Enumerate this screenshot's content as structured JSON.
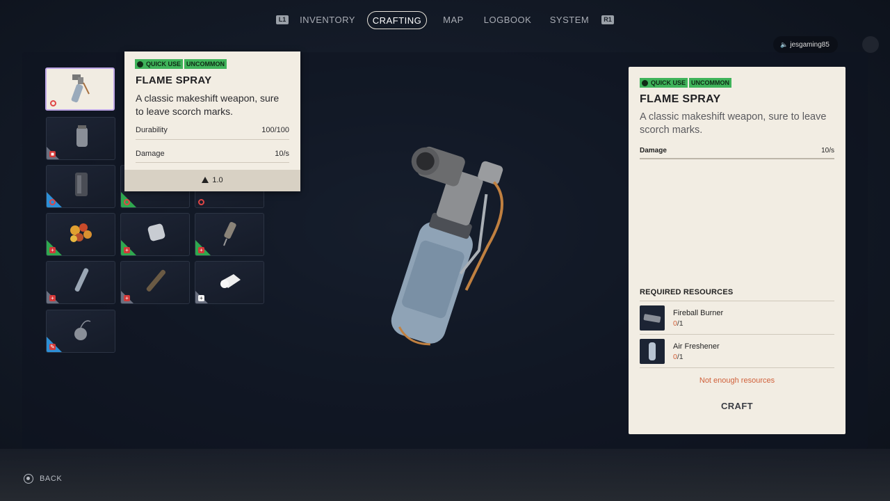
{
  "nav": {
    "left_shoulder": "L1",
    "right_shoulder": "R1",
    "tabs": [
      {
        "label": "INVENTORY"
      },
      {
        "label": "CRAFTING"
      },
      {
        "label": "MAP"
      },
      {
        "label": "LOGBOOK"
      },
      {
        "label": "SYSTEM"
      }
    ],
    "active_tab": "CRAFTING"
  },
  "user": {
    "username": "jesgaming85",
    "icon": "speaker-icon"
  },
  "grid": {
    "slots": [
      {
        "item": "flame-spray",
        "rarity": "uncommon",
        "badge": "ring",
        "selected": true
      },
      {
        "item": "canister",
        "rarity": "common",
        "badge": "red"
      },
      {
        "item": "backpack-weapon",
        "rarity": "rare",
        "badge": "ring"
      },
      {
        "item": "hidden-under-tooltip",
        "rarity": "uncommon",
        "badge": "ring"
      },
      {
        "item": "hidden-under-tooltip",
        "rarity": "common",
        "badge": "ring"
      },
      {
        "item": "fruit-pile",
        "rarity": "uncommon",
        "badge": "red"
      },
      {
        "item": "bandage-roll",
        "rarity": "uncommon",
        "badge": "red"
      },
      {
        "item": "syringe-injector",
        "rarity": "uncommon",
        "badge": "red"
      },
      {
        "item": "pipe-tube",
        "rarity": "common",
        "badge": "red"
      },
      {
        "item": "wrench-tool",
        "rarity": "common",
        "badge": "red"
      },
      {
        "item": "gauze-bandage",
        "rarity": "common",
        "badge": "white"
      },
      {
        "item": "pocket-watch",
        "rarity": "rare",
        "badge": "red"
      }
    ]
  },
  "tooltip": {
    "tags": [
      "QUICK USE",
      "UNCOMMON"
    ],
    "title": "FLAME SPRAY",
    "description": "A classic makeshift weapon, sure to leave scorch marks.",
    "stats": [
      {
        "label": "Durability",
        "value": "100/100"
      },
      {
        "label": "Damage",
        "value": "10/s"
      }
    ],
    "weight": "1.0"
  },
  "detail": {
    "tags": [
      "QUICK USE",
      "UNCOMMON"
    ],
    "title": "FLAME SPRAY",
    "description": "A classic makeshift weapon, sure to leave scorch marks.",
    "stat": {
      "label": "Damage",
      "value": "10/s"
    },
    "required_heading": "REQUIRED RESOURCES",
    "resources": [
      {
        "name": "Fireball Burner",
        "have": "0",
        "need": "/1"
      },
      {
        "name": "Air Freshener",
        "have": "0",
        "need": "/1"
      }
    ],
    "warning": "Not enough resources",
    "craft_label": "CRAFT"
  },
  "footer": {
    "back_label": "BACK"
  },
  "colors": {
    "accent_green": "#3fb35a",
    "rarity_blue": "#2d8fd6",
    "warning_orange": "#d0603a",
    "panel_cream": "#f2ede3"
  }
}
